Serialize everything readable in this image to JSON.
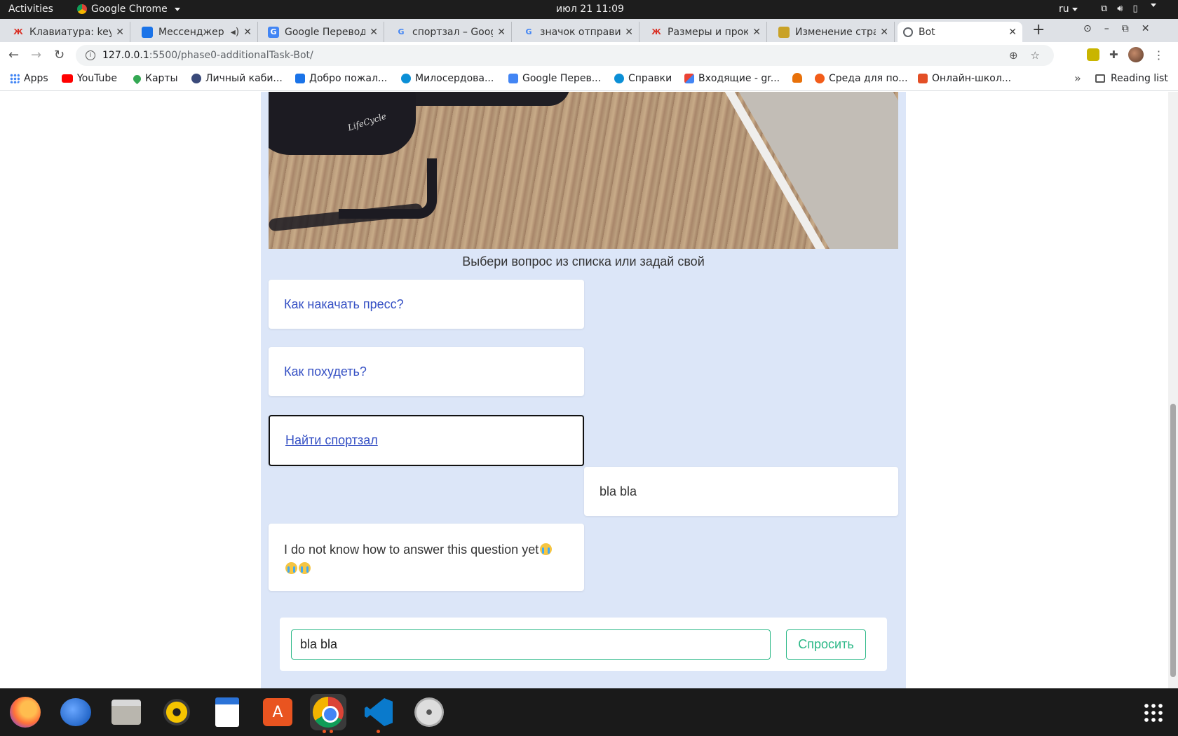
{
  "system": {
    "activities": "Activities",
    "app_name": "Google Chrome",
    "clock": "июл 21  11:09",
    "lang": "ru"
  },
  "tabs": [
    {
      "title": "Клавиатура: keyc",
      "icon_color": "#d93025"
    },
    {
      "title": "Мессенджер",
      "icon_color": "#1a73e8"
    },
    {
      "title": "Google Переводчик",
      "icon_color": "#4285f4"
    },
    {
      "title": "спортзал – Google",
      "icon_color": "#4285f4"
    },
    {
      "title": "значок отправить",
      "icon_color": "#4285f4"
    },
    {
      "title": "Размеры и прокр",
      "icon_color": "#d93025"
    },
    {
      "title": "Изменение стран",
      "icon_color": "#c9a227"
    },
    {
      "title": "Bot",
      "icon_color": "#5f6368"
    }
  ],
  "toolbar": {
    "url_host": "127.0.0.1",
    "url_rest": ":5500/phase0-additionalTask-Bot/"
  },
  "bookmarks": [
    {
      "label": "Apps",
      "icon_color": "#4285f4"
    },
    {
      "label": "YouTube",
      "icon_color": "#ff0000"
    },
    {
      "label": "Карты",
      "icon_color": "#34a853"
    },
    {
      "label": "Личный каби...",
      "icon_color": "#3a4a7a"
    },
    {
      "label": "Добро пожал...",
      "icon_color": "#1a73e8"
    },
    {
      "label": "Милосердова...",
      "icon_color": "#0b8fd6"
    },
    {
      "label": "Google Перев...",
      "icon_color": "#4285f4"
    },
    {
      "label": "Справки",
      "icon_color": "#0b8fd6"
    },
    {
      "label": "Входящие - gr...",
      "icon_color": "#ea4335"
    },
    {
      "label": "",
      "icon_color": "#e8710a"
    },
    {
      "label": "Среда для по...",
      "icon_color": "#f25c19"
    },
    {
      "label": "Онлайн-школ...",
      "icon_color": "#e34f26"
    }
  ],
  "reading_list": "Reading list",
  "bot": {
    "hero_logo": "LifeCycle",
    "prompt": "Выбери вопрос из списка или задай свой",
    "options": [
      "Как накачать пресс?",
      "Как похудеть?",
      "Найти спортзал"
    ],
    "user_message": "bla bla",
    "bot_reply": "I do not know how to answer this question yet",
    "input_value": "bla bla",
    "ask_button": "Спросить"
  },
  "colors": {
    "accent_green": "#2bb887",
    "option_link": "#3550c4",
    "panel_bg": "#dce6f8"
  },
  "dock": [
    "firefox-icon",
    "thunderbird-icon",
    "files-icon",
    "rhythmbox-icon",
    "writer-icon",
    "software-icon",
    "chrome-icon",
    "vscode-icon",
    "disc-icon",
    "show-apps-icon"
  ]
}
